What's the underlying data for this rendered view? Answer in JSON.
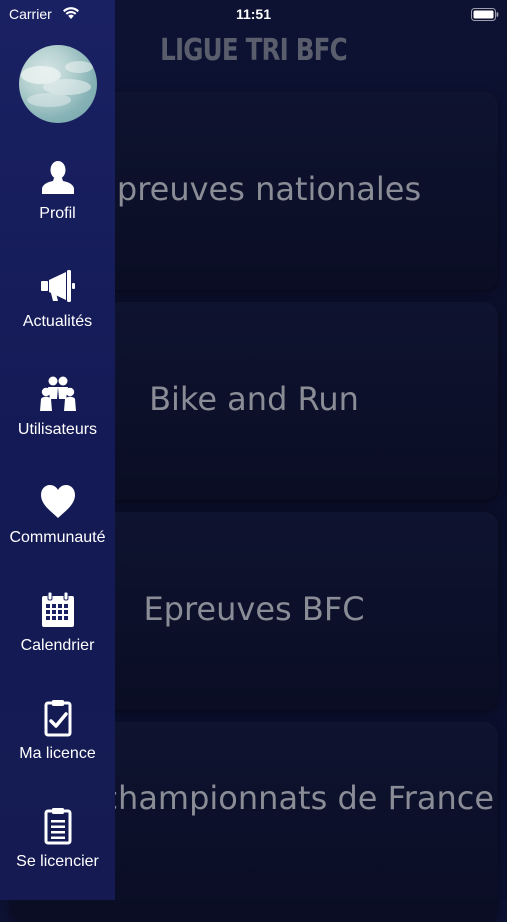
{
  "status_bar": {
    "carrier": "Carrier",
    "time": "11:51",
    "wifi_icon": "wifi-icon",
    "battery_icon": "battery-icon"
  },
  "app": {
    "title": "LIGUE TRI BFC"
  },
  "categories": [
    {
      "label": "preuves nationales"
    },
    {
      "label": "Bike and Run"
    },
    {
      "label": "Epreuves BFC"
    },
    {
      "label": "alités championnats de France"
    }
  ],
  "drawer": {
    "avatar": "avatar",
    "items": [
      {
        "label": "Profil",
        "icon": "person-icon"
      },
      {
        "label": "Actualités",
        "icon": "megaphone-icon"
      },
      {
        "label": "Utilisateurs",
        "icon": "users-icon"
      },
      {
        "label": "Communauté",
        "icon": "heart-icon"
      },
      {
        "label": "Calendrier",
        "icon": "calendar-icon"
      },
      {
        "label": "Ma licence",
        "icon": "clipboard-check-icon"
      },
      {
        "label": "Se licencier",
        "icon": "clipboard-list-icon"
      }
    ]
  },
  "colors": {
    "drawer_background": "#1a2163",
    "page_background": "#0a0e27",
    "dimmed_text": "#8a8c96",
    "title_text": "#595d6c"
  }
}
